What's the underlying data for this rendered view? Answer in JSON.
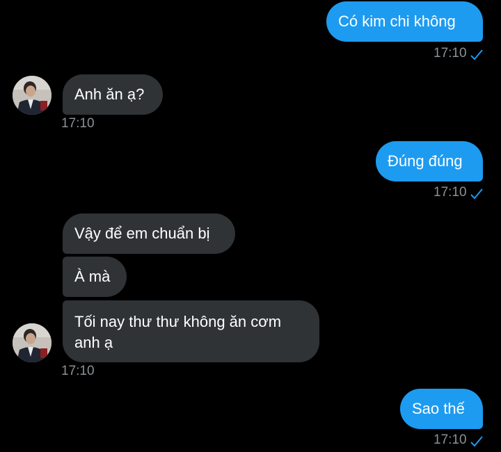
{
  "messages": [
    {
      "text": "Có kim chi không",
      "time": "17:10"
    },
    {
      "text": "Anh ăn ạ?",
      "time": "17:10"
    },
    {
      "text": "Đúng đúng",
      "time": "17:10"
    },
    {
      "text": "Vậy để em chuẩn bị"
    },
    {
      "text": "À mà"
    },
    {
      "text_line1": "Tối nay thư thư không ăn cơm",
      "text_line2": "anh ạ",
      "time": "17:10"
    },
    {
      "text": "Sao thế",
      "time": "17:10"
    }
  ],
  "colors": {
    "outgoing_bubble": "#1d9bf0",
    "incoming_bubble": "#2f3336",
    "timestamp": "#8b9196",
    "read_check": "#1d9bf0",
    "background": "#000000"
  },
  "icons": {
    "read_receipt": "check-icon",
    "avatar": "contact-avatar"
  }
}
